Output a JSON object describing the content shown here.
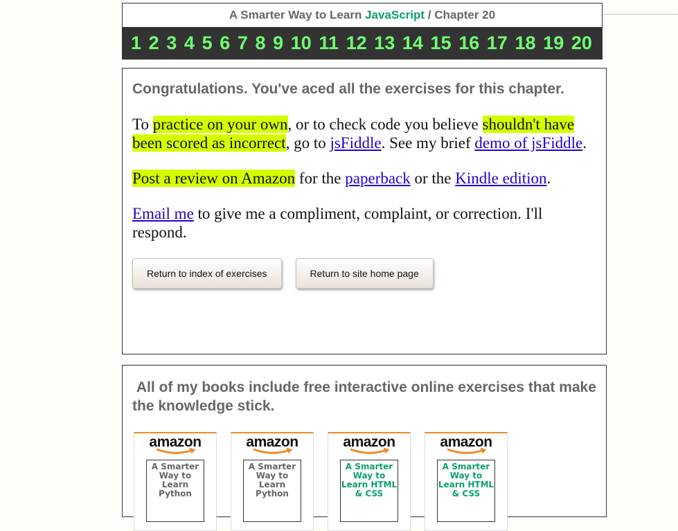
{
  "header": {
    "title_prefix": "A Smarter Way to Learn ",
    "title_accent": "JavaScript",
    "title_suffix": " / Chapter 20",
    "accent_color": "#0aa06e",
    "chapters": [
      "1",
      "2",
      "3",
      "4",
      "5",
      "6",
      "7",
      "8",
      "9",
      "10",
      "11",
      "12",
      "13",
      "14",
      "15",
      "16",
      "17",
      "18",
      "19",
      "20"
    ]
  },
  "content": {
    "congrats": "Congratulations. You've aced all the exercises for this chapter.",
    "p1": {
      "t1": "To ",
      "hl1": "practice on your own",
      "t2": ", or to check code you believe ",
      "hl2": "shouldn't have been scored as incorrect",
      "t3": ", go to ",
      "link1": "jsFiddle",
      "t4": ". See my brief ",
      "link2": "demo of jsFiddle",
      "t5": "."
    },
    "p2": {
      "hl": "Post a review on Amazon",
      "t1": " for the ",
      "link1": "paperback",
      "t2": " or the ",
      "link2": "Kindle edition",
      "t3": "."
    },
    "p3": {
      "link": "Email me",
      "t1": " to give me a compliment, complaint, or correction. I'll respond."
    },
    "buttons": {
      "index": "Return to index of exercises",
      "home": "Return to site home page"
    },
    "highlight_color": "#d4ff00"
  },
  "books": {
    "heading": " All of my books include free interactive online exercises that make the knowledge stick.",
    "items": [
      {
        "store": "amazon",
        "cover": "A Smarter Way to Learn Python"
      },
      {
        "store": "amazon",
        "cover": "A Smarter Way to Learn Python"
      },
      {
        "store": "amazon",
        "cover": "A Smarter Way to Learn HTML & CSS"
      },
      {
        "store": "amazon",
        "cover": "A Smarter Way to Learn HTML & CSS"
      }
    ]
  }
}
